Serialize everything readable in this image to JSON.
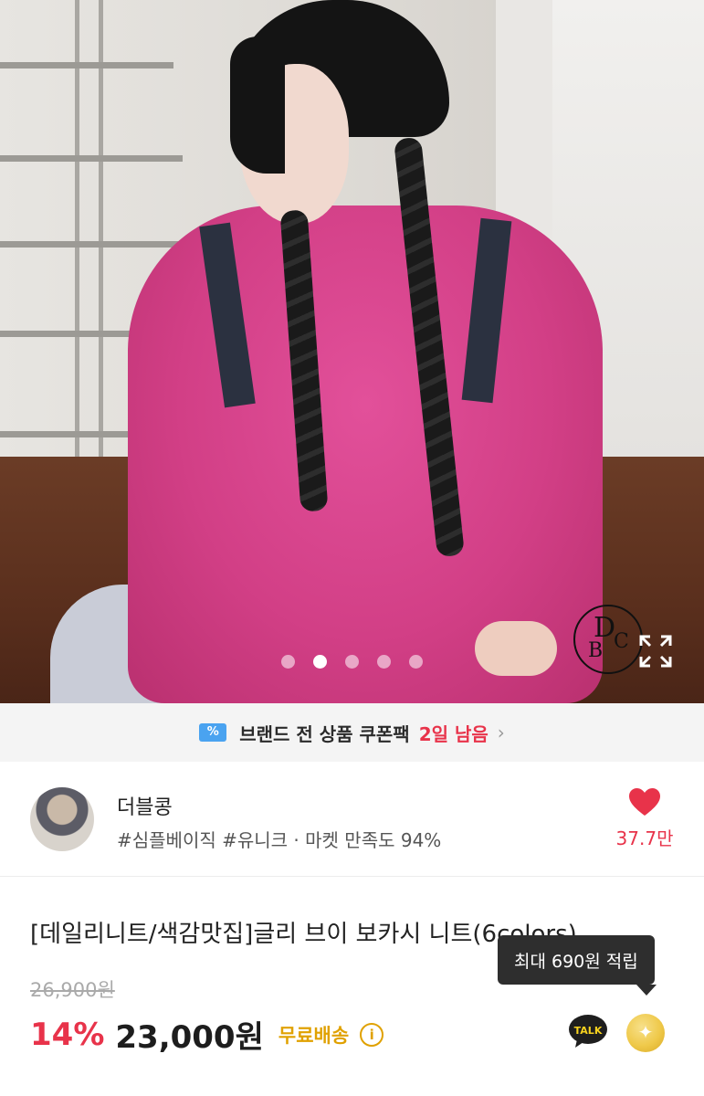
{
  "hero": {
    "image_alt": "pink v-neck knit sweater product photo",
    "carousel_index": 2,
    "carousel_count": 5,
    "expand_icon": "expand-icon",
    "logo_letters": [
      "D",
      "B",
      "C"
    ]
  },
  "coupon": {
    "icon": "coupon-icon",
    "text": "브랜드 전 상품 쿠폰팩",
    "remaining": "2일 남음",
    "chevron": "›"
  },
  "seller": {
    "name": "더블콩",
    "tags": "#심플베이직 #유니크 · 마켓 만족도 94%",
    "like_count": "37.7만",
    "like_icon": "heart-icon"
  },
  "product": {
    "title": "[데일리니트/색감맛집]글리 브이 보카시 니트(6colors)",
    "original_price": "26,900원",
    "discount": "14%",
    "price": "23,000원",
    "shipping": "무료배송",
    "info_icon": "i",
    "reward_tooltip": "최대 690원 적립",
    "talk_label": "TALK"
  },
  "colors": {
    "accent_red": "#e8334a",
    "shipping_gold": "#e0a100",
    "coupon_blue": "#4aa3f0"
  }
}
